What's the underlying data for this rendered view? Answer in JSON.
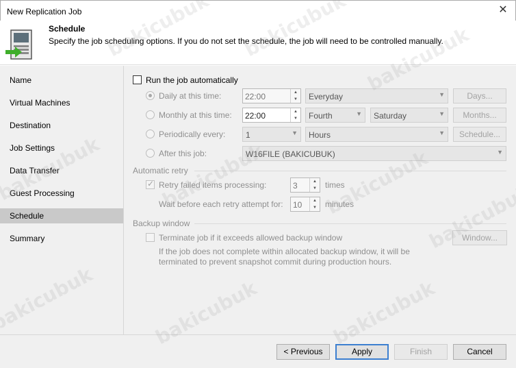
{
  "window": {
    "title": "New Replication Job"
  },
  "header": {
    "title": "Schedule",
    "description": "Specify the job scheduling options. If you do not set the schedule, the job will need to be controlled manually."
  },
  "sidebar": {
    "items": [
      {
        "label": "Name"
      },
      {
        "label": "Virtual Machines"
      },
      {
        "label": "Destination"
      },
      {
        "label": "Job Settings"
      },
      {
        "label": "Data Transfer"
      },
      {
        "label": "Guest Processing"
      },
      {
        "label": "Schedule",
        "active": true
      },
      {
        "label": "Summary"
      }
    ]
  },
  "schedule": {
    "run_auto_label": "Run the job automatically",
    "run_auto_checked": false,
    "daily": {
      "label": "Daily at this time:",
      "time": "22:00",
      "option": "Everyday",
      "button": "Days..."
    },
    "monthly": {
      "label": "Monthly at this time:",
      "time": "22:00",
      "week": "Fourth",
      "day": "Saturday",
      "button": "Months..."
    },
    "periodic": {
      "label": "Periodically every:",
      "value": "1",
      "unit": "Hours",
      "button": "Schedule..."
    },
    "after": {
      "label": "After this job:",
      "job": "W16FILE (BAKICUBUK)"
    }
  },
  "retry": {
    "section": "Automatic retry",
    "failed_label": "Retry failed items processing:",
    "failed_value": "3",
    "failed_unit": "times",
    "wait_label": "Wait before each retry attempt for:",
    "wait_value": "10",
    "wait_unit": "minutes"
  },
  "backup_window": {
    "section": "Backup window",
    "terminate_label": "Terminate job if it exceeds allowed backup window",
    "note_line1": "If the job does not complete within allocated backup window, it will be",
    "note_line2": "terminated to prevent snapshot commit during production hours.",
    "button": "Window..."
  },
  "footer": {
    "previous": "< Previous",
    "apply": "Apply",
    "finish": "Finish",
    "cancel": "Cancel"
  },
  "watermark": "bakicubuk"
}
